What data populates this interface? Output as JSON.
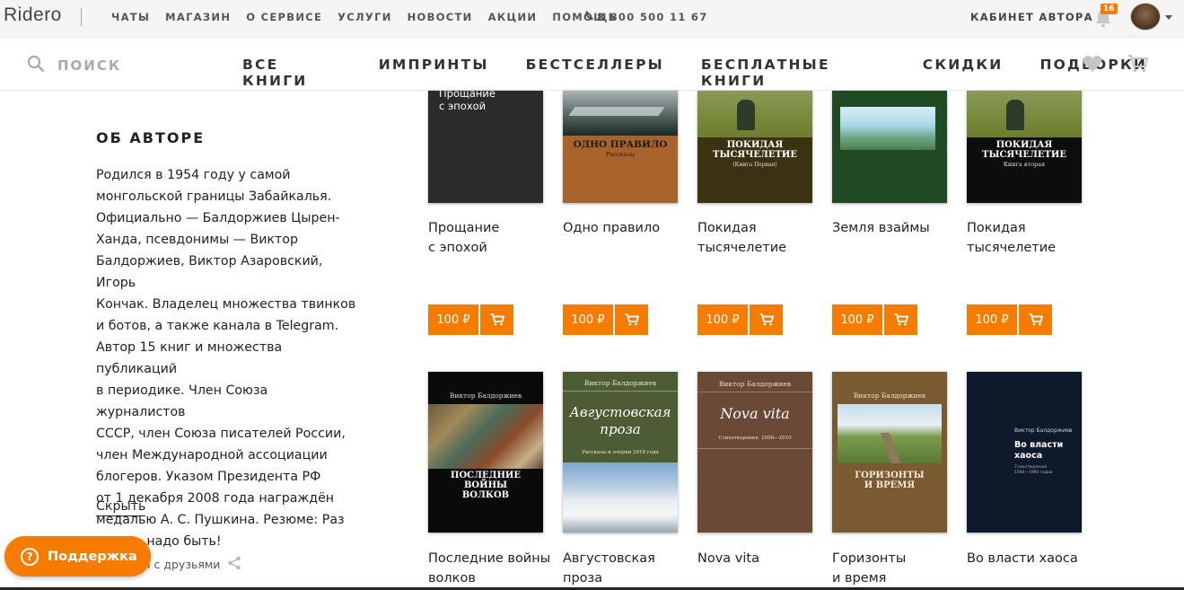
{
  "topbar": {
    "logo": "Ridero",
    "nav": [
      "ЧАТЫ",
      "МАГАЗИН",
      "О СЕРВИСЕ",
      "УСЛУГИ",
      "НОВОСТИ",
      "АКЦИИ",
      "ПОМОЩЬ"
    ],
    "phone": "8 800 500 11 67",
    "cabinet": "КАБИНЕТ АВТОРА",
    "notifications": "16"
  },
  "subnav": {
    "search_label": "ПОИСК",
    "items": [
      "ВСЕ КНИГИ",
      "ИМПРИНТЫ",
      "БЕСТСЕЛЛЕРЫ",
      "БЕСПЛАТНЫЕ КНИГИ",
      "СКИДКИ",
      "ПОДБОРКИ"
    ]
  },
  "about": {
    "heading": "ОБ АВТОРЕ",
    "lines": [
      "Родился в 1954 году у самой",
      "монгольской границы Забайкалья.",
      "Официально — Балдоржиев Цырен-",
      "Ханда, псевдонимы — Виктор",
      "Балдоржиев, Виктор Азаровский, Игорь",
      "Кончак. Владелец множества твинков",
      "и ботов, а также канала в Telegram.",
      "Автор 15 книг и множества публикаций",
      "в периодике. Член Союза журналистов",
      "СССР, член Союза писателей России,",
      "член Международной ассоциации",
      "блогеров. Указом Президента РФ",
      "от 1 декабря 2008 года награждён",
      "медалью А. С. Пушкина. Резюме: Раз",
      "есть — надо быть!"
    ],
    "hide_link": "Скрыть",
    "share_label": "я с друзьями"
  },
  "support": {
    "label": "Поддержка",
    "icon": "?"
  },
  "books_row1": [
    {
      "title_lines": [
        "Прощание",
        "с эпохой"
      ],
      "cover_text": [
        "Прощание",
        "с эпохой"
      ],
      "price": "100 ₽"
    },
    {
      "title_lines": [
        "Одно правило"
      ],
      "cover_text": [
        "ОДНО ПРАВИЛО",
        "Рассказы"
      ],
      "price": "100 ₽"
    },
    {
      "title_lines": [
        "Покидая",
        "тысячелетие"
      ],
      "cover_text": [
        "ПОКИДАЯ",
        "ТЫСЯЧЕЛЕТИЕ",
        "(Книга Первая)"
      ],
      "price": "100 ₽"
    },
    {
      "title_lines": [
        "Земля взаймы"
      ],
      "cover_text": [],
      "price": "100 ₽"
    },
    {
      "title_lines": [
        "Покидая",
        "тысячелетие"
      ],
      "cover_text": [
        "ПОКИДАЯ",
        "ТЫСЯЧЕЛЕТИЕ",
        "Книга вторая"
      ],
      "price": "100 ₽"
    }
  ],
  "books_row2": [
    {
      "title_lines": [
        "Последние войны",
        "волков"
      ],
      "cover_author": "Виктор Балдоржиев",
      "cover_text": [
        "ПОСЛЕДНИЕ ВОЙНЫ",
        "ВОЛКОВ"
      ]
    },
    {
      "title_lines": [
        "Августовская",
        "проза"
      ],
      "cover_author": "Виктор Балдоржиев",
      "cover_text": [
        "Августовская",
        "проза",
        "Рассказы и очерки 2018 года"
      ]
    },
    {
      "title_lines": [
        "Nova vita"
      ],
      "cover_author": "Виктор Балдоржиев",
      "cover_text": [
        "Nova vita",
        "Стихотворения. 2008—2010"
      ]
    },
    {
      "title_lines": [
        "Горизонты",
        "и время"
      ],
      "cover_author": "Виктор Балдоржиев",
      "cover_text": [
        "ГОРИЗОНТЫ",
        "И ВРЕМЯ"
      ]
    },
    {
      "title_lines": [
        "Во власти хаоса"
      ],
      "cover_author": "Виктор Балдоржиев",
      "cover_text": [
        "Во власти",
        "хаоса",
        "Стихотворения",
        "1994—1994 годов"
      ]
    }
  ],
  "colors": {
    "accent": "#f57c00"
  }
}
